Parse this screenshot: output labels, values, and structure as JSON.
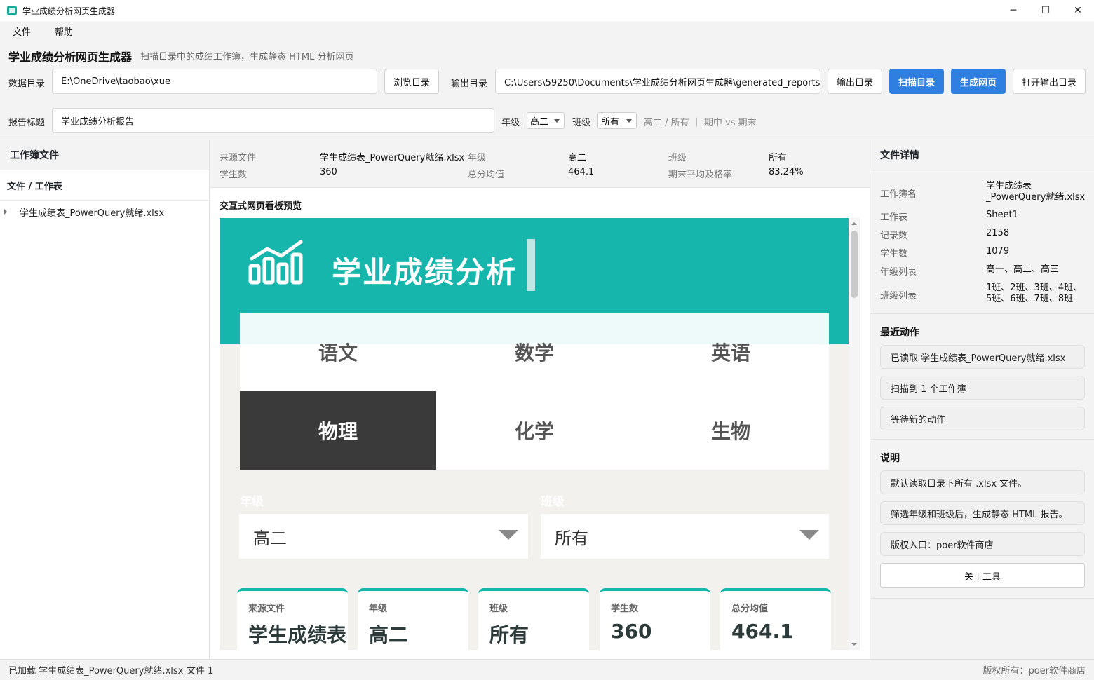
{
  "window": {
    "title": "学业成绩分析网页生成器",
    "minimize": "─",
    "maximize": "☐",
    "close": "✕"
  },
  "menu": [
    "文件",
    "帮助"
  ],
  "header": {
    "app_title": "学业成绩分析网页生成器",
    "subtitle": "扫描目录中的成绩工作簿，生成静态 HTML 分析网页",
    "data_dir_label": "数据目录",
    "data_dir_value": "E:\\OneDrive\\taobao\\xue",
    "browse_label": "浏览目录",
    "output_dir_label": "输出目录",
    "output_dir_value": "C:\\Users\\59250\\Documents\\学业成绩分析网页生成器\\generated_reports",
    "output_btn_label": "输出目录",
    "scan_label": "扫描目录",
    "generate_label": "生成网页",
    "open_output_label": "打开输出目录",
    "report_title_label": "报告标题",
    "report_title_value": "学业成绩分析报告",
    "grade_label": "年级",
    "grade_value": "高二",
    "class_label": "班级",
    "class_value": "所有",
    "summary": "高二 / 所有 ｜ 期中 vs 期末"
  },
  "left_panel": {
    "title": "工作簿文件",
    "tree_header": "文件 / 工作表",
    "files": [
      "学生成绩表_PowerQuery就绪.xlsx"
    ]
  },
  "stats": {
    "source_file_label": "来源文件",
    "source_file_value": "学生成绩表_PowerQuery就绪.xlsx",
    "grade_label": "年级",
    "grade_value": "高二",
    "class_label": "班级",
    "class_value": "所有",
    "students_label": "学生数",
    "students_value": "360",
    "avg_label": "总分均值",
    "avg_value": "464.1",
    "pass_label": "期末平均及格率",
    "pass_value": "83.24%"
  },
  "preview": {
    "title": "交互式网页看板预览",
    "banner_title": "学业成绩分析",
    "subjects": [
      "语文",
      "数学",
      "英语",
      "物理",
      "化学",
      "生物"
    ],
    "active_subject": "物理",
    "grade_filter_label": "年级",
    "grade_filter_value": "高二",
    "class_filter_label": "班级",
    "class_filter_value": "所有",
    "cards": [
      {
        "label": "来源文件",
        "value": "学生成绩表"
      },
      {
        "label": "年级",
        "value": "高二"
      },
      {
        "label": "班级",
        "value": "所有"
      },
      {
        "label": "学生数",
        "value": "360"
      },
      {
        "label": "总分均值",
        "value": "464.1"
      }
    ]
  },
  "right_panel": {
    "title": "文件详情",
    "details": [
      {
        "key": "工作簿名",
        "value": "学生成绩表_PowerQuery就绪.xlsx"
      },
      {
        "key": "工作表",
        "value": "Sheet1"
      },
      {
        "key": "记录数",
        "value": "2158"
      },
      {
        "key": "学生数",
        "value": "1079"
      },
      {
        "key": "年级列表",
        "value": "高一、高二、高三"
      },
      {
        "key": "班级列表",
        "value": "1班、2班、3班、4班、5班、6班、7班、8班"
      }
    ],
    "recent_title": "最近动作",
    "recent": [
      "已读取 学生成绩表_PowerQuery就绪.xlsx",
      "扫描到 1 个工作簿",
      "等待新的动作"
    ],
    "notes_title": "说明",
    "notes": [
      "默认读取目录下所有 .xlsx 文件。",
      "筛选年级和班级后，生成静态 HTML 报告。",
      "版权入口：poer软件商店"
    ],
    "about_label": "关于工具"
  },
  "statusbar": {
    "loaded": "已加载 学生成绩表_PowerQuery就绪.xlsx",
    "count": "文件 1",
    "copyright": "版权所有：poer软件商店"
  },
  "colors": {
    "teal": "#16b6ad",
    "primary": "#2f7fe0",
    "dark_tile": "#3a3a3a"
  },
  "icons": {
    "banner": "bar-chart-trend-icon"
  }
}
